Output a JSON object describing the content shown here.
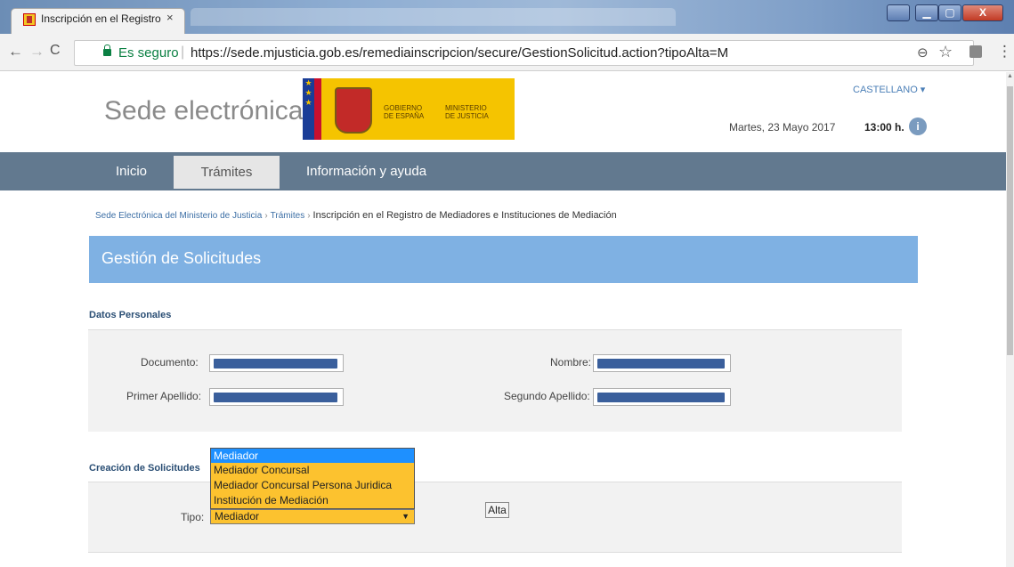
{
  "browser": {
    "tab_title": "Inscripción en el Registro",
    "tab_close": "×",
    "secure_label": "Es seguro",
    "separator": "|",
    "url": "https://sede.mjusticia.gob.es/remediainscripcion/secure/GestionSolicitud.action?tipoAlta=M",
    "icons": {
      "back": "←",
      "forward": "→",
      "reload": "C",
      "zoom": "⊖",
      "bookmark": "☆",
      "menu": "⋮",
      "minimize": "▁",
      "maximize": "▢",
      "close": "X"
    }
  },
  "header": {
    "site_title": "Sede electrónica",
    "logo_gobierno": "GOBIERNO\nDE ESPAÑA",
    "logo_ministerio": "MINISTERIO\nDE JUSTICIA",
    "language": "CASTELLANO ▾",
    "date": "Martes, 23 Mayo 2017",
    "time": "13:00 h.",
    "info_glyph": "i"
  },
  "nav": {
    "items": [
      "Inicio",
      "Trámites",
      "Información y ayuda"
    ],
    "active": "Trámites"
  },
  "breadcrumb": {
    "items": [
      "Sede Electrónica del Ministerio de Justicia",
      "Trámites"
    ],
    "current": "Inscripción en el Registro de Mediadores e Instituciones de Mediación",
    "separator": "›"
  },
  "page": {
    "title": "Gestión de Solicitudes"
  },
  "datos_personales": {
    "title": "Datos Personales",
    "documento_label": "Documento:",
    "nombre_label": "Nombre:",
    "primer_apellido_label": "Primer Apellido:",
    "segundo_apellido_label": "Segundo Apellido:"
  },
  "creacion": {
    "title": "Creación de Solicitudes",
    "tipo_label": "Tipo:",
    "selected": "Mediador",
    "options": [
      "Mediador",
      "Mediador Concursal",
      "Mediador Concursal Persona Juridica",
      "Institución de Mediación"
    ],
    "alta_label": "Alta"
  },
  "colors": {
    "nav_bg": "#62798f",
    "title_band": "#7fb1e3",
    "select_bg": "#fcc22f",
    "option_highlight": "#1e90ff",
    "secure_green": "#0b8043"
  }
}
